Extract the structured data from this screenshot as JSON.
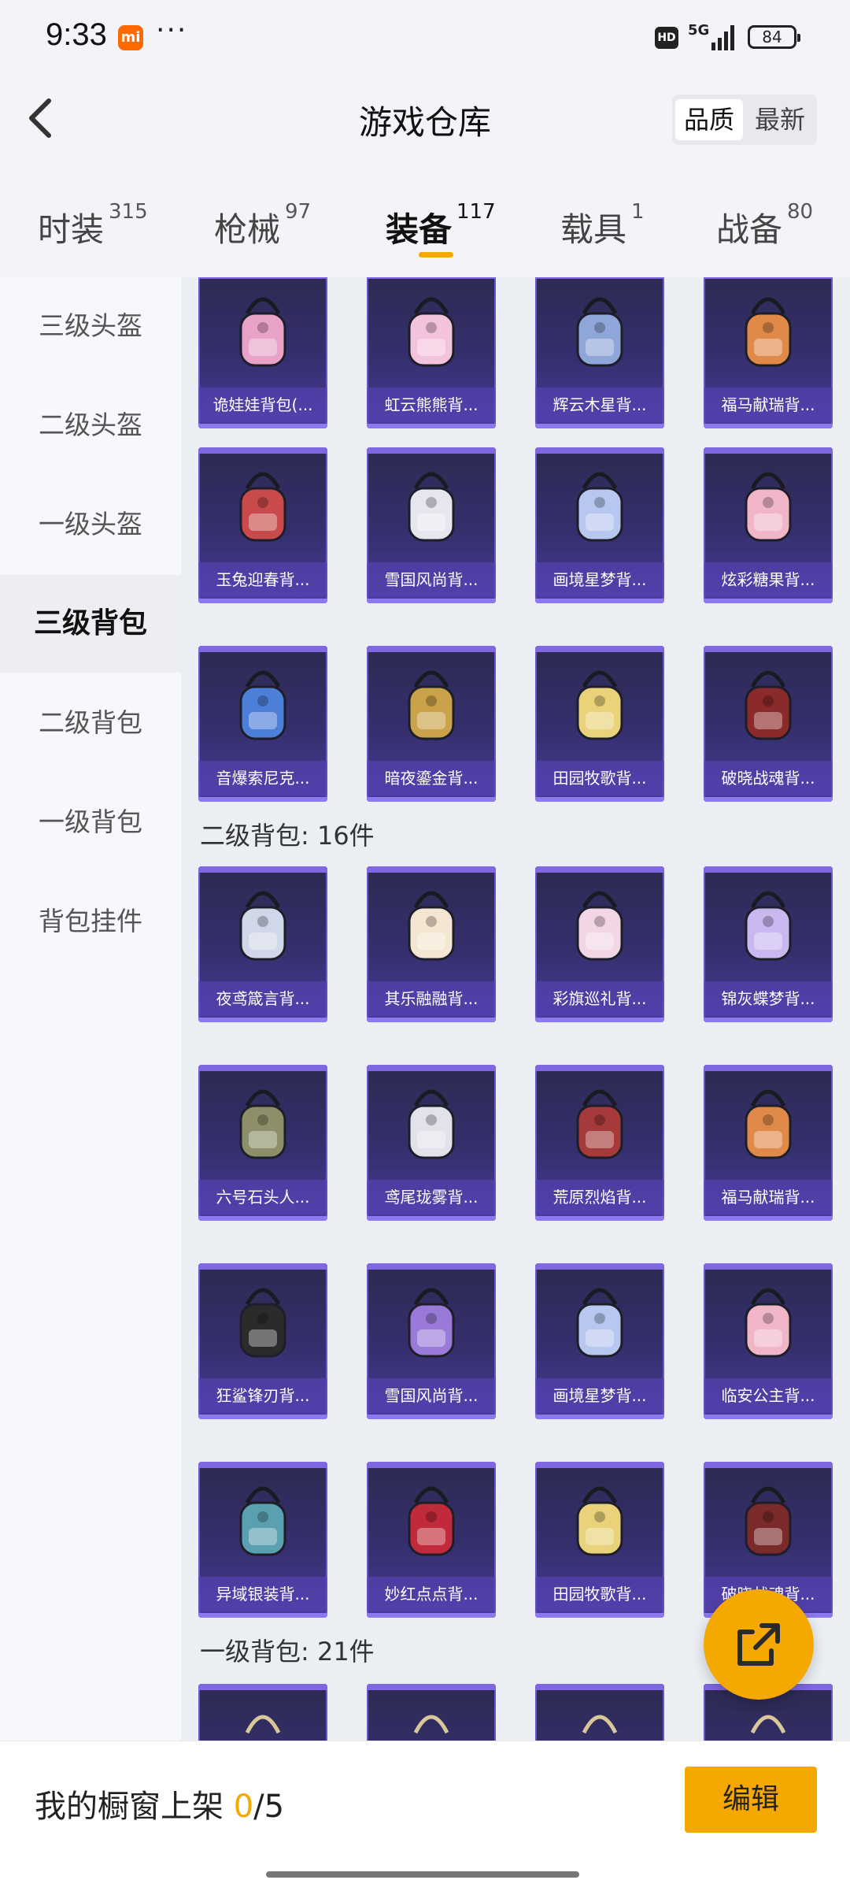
{
  "status_bar": {
    "time": "9:33",
    "app_badge": "mi",
    "more": "···",
    "hd": "HD",
    "network": "5G",
    "battery": "84"
  },
  "header": {
    "back_icon": "chevron-left-icon",
    "title": "游戏仓库",
    "sort_options": [
      "品质",
      "最新"
    ],
    "selected_sort": "品质"
  },
  "tabs": [
    {
      "label": "时装",
      "count": "315"
    },
    {
      "label": "枪械",
      "count": "97"
    },
    {
      "label": "装备",
      "count": "117"
    },
    {
      "label": "载具",
      "count": "1"
    },
    {
      "label": "战备",
      "count": "80"
    }
  ],
  "active_tab": "装备",
  "side_nav": [
    {
      "label": "三级头盔"
    },
    {
      "label": "二级头盔"
    },
    {
      "label": "一级头盔"
    },
    {
      "label": "三级背包"
    },
    {
      "label": "二级背包"
    },
    {
      "label": "一级背包"
    },
    {
      "label": "背包挂件"
    }
  ],
  "active_side_nav": "三级背包",
  "sections": {
    "level2": "二级背包: 16件",
    "level1": "一级背包: 21件"
  },
  "items_level3": [
    "诡娃娃背包(...",
    "虹云熊熊背...",
    "辉云木星背...",
    "福马献瑞背...",
    "玉兔迎春背...",
    "雪国风尚背...",
    "画境星梦背...",
    "炫彩糖果背...",
    "音爆索尼克...",
    "暗夜鎏金背...",
    "田园牧歌背...",
    "破晓战魂背..."
  ],
  "items_level2": [
    "夜鸢箴言背...",
    "其乐融融背...",
    "彩旗巡礼背...",
    "锦灰蝶梦背...",
    "六号石头人...",
    "鸢尾珑雾背...",
    "荒原烈焰背...",
    "福马献瑞背...",
    "狂鲨锋刃背...",
    "雪国风尚背...",
    "画境星梦背...",
    "临安公主背...",
    "异域银装背...",
    "妙红点点背...",
    "田园牧歌背...",
    "破晓战魂背..."
  ],
  "share_icon": "share-external-icon",
  "bottom_bar": {
    "shelf_label": "我的橱窗上架",
    "shelf_count": "0",
    "shelf_total": "/5",
    "edit_label": "编辑"
  },
  "colors": {
    "accent": "#f5a800",
    "card_purple": "#4a3c9a"
  }
}
